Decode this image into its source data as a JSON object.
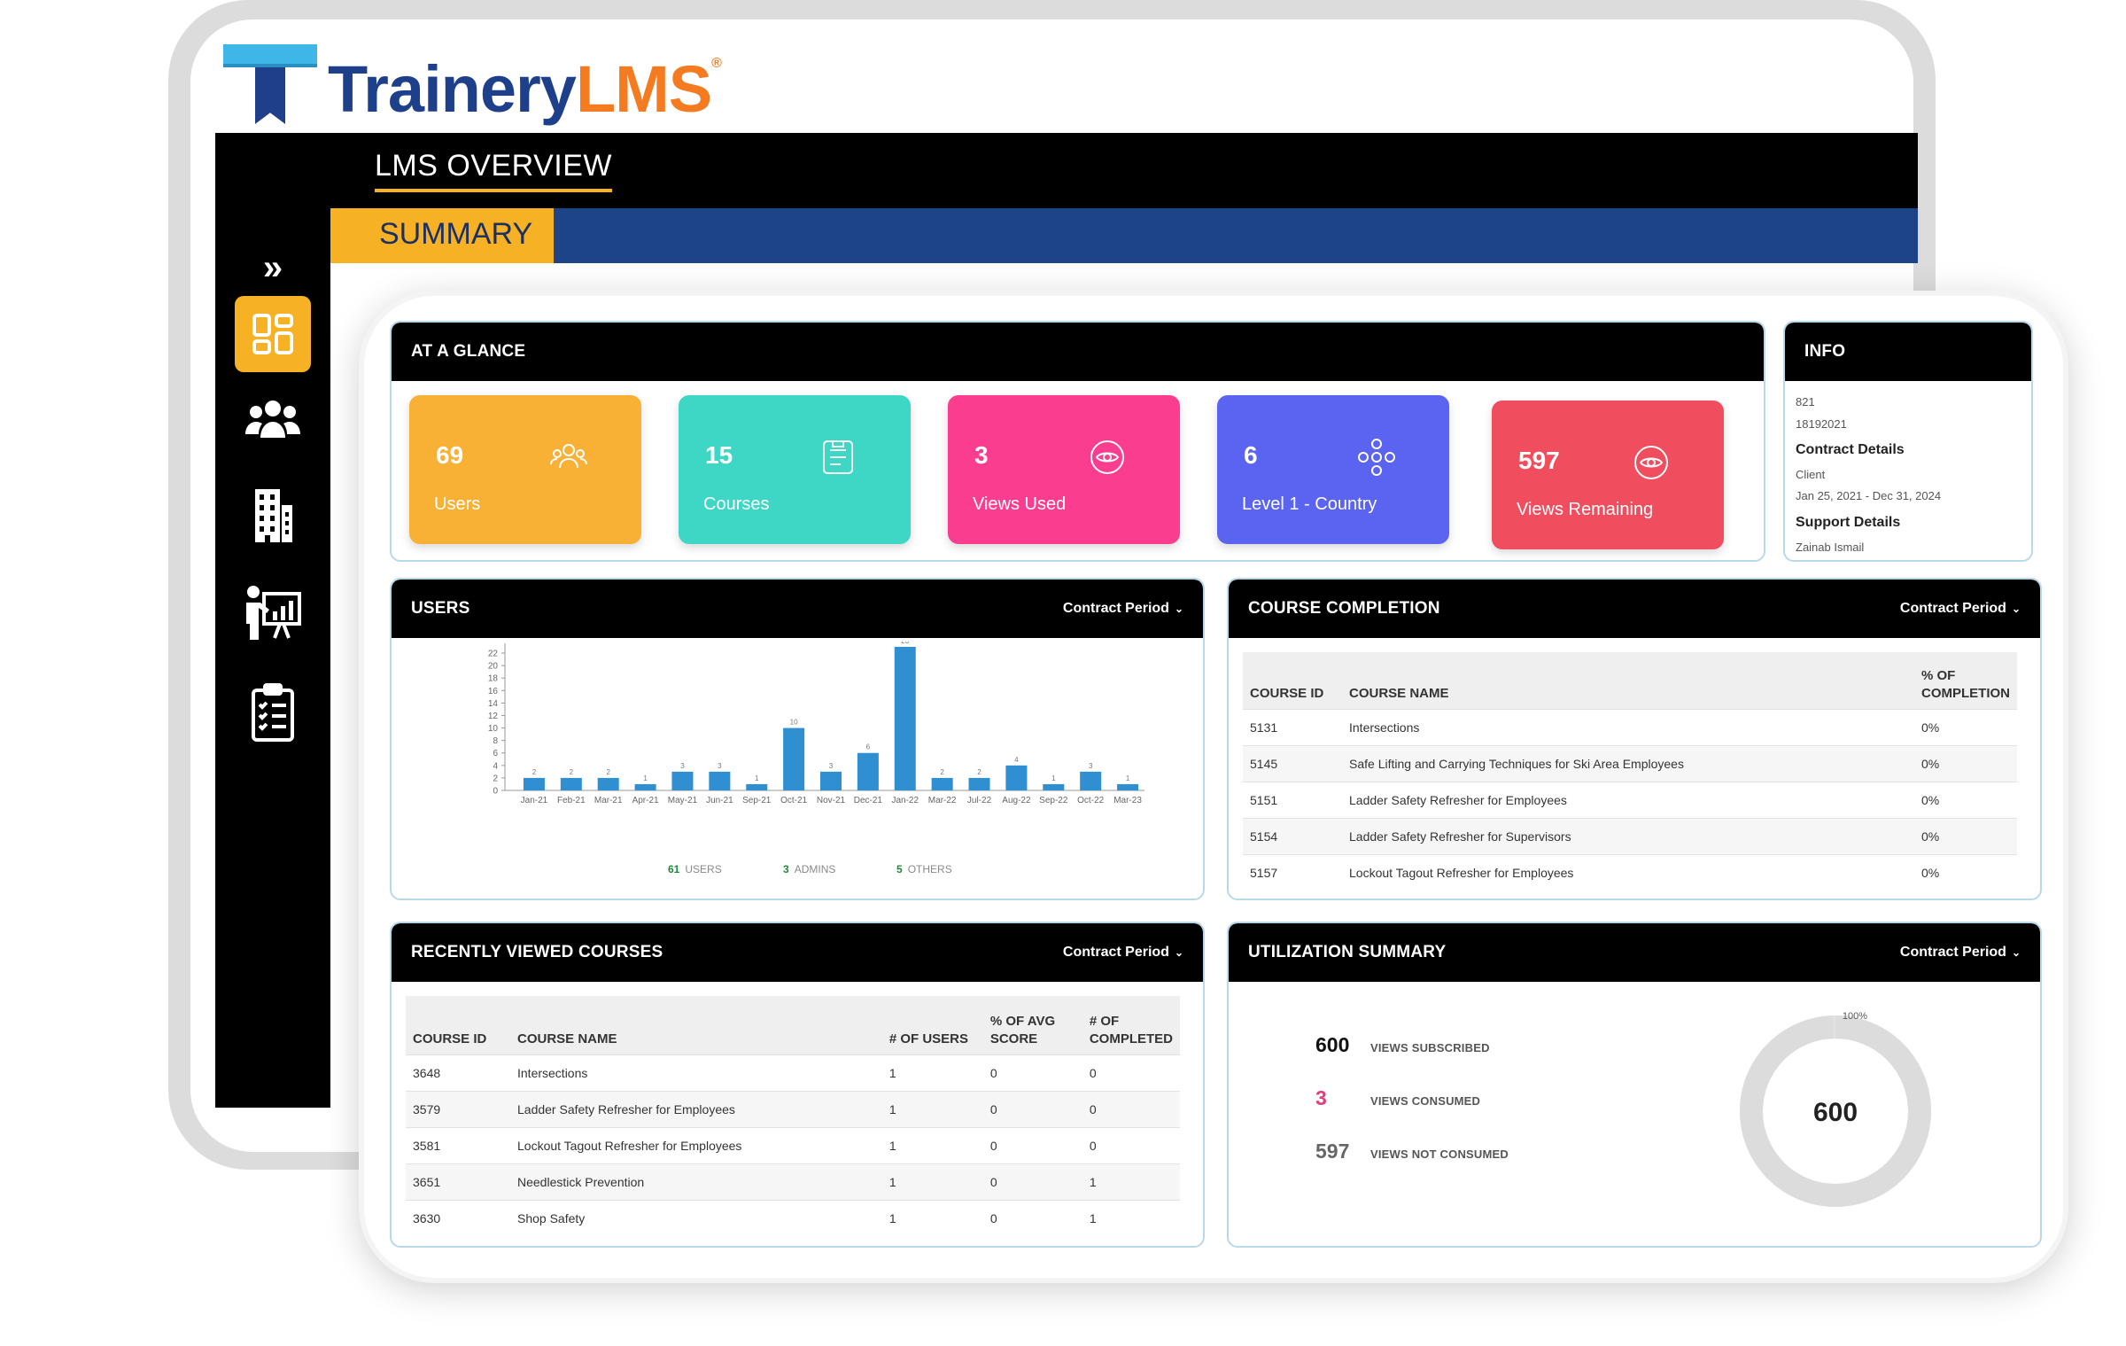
{
  "brand": {
    "name_primary": "Trainery",
    "name_accent": "LMS",
    "reg": "®"
  },
  "header": {
    "title": "LMS OVERVIEW",
    "tab": "SUMMARY"
  },
  "sidebar": {
    "items": [
      {
        "name": "dashboard-icon"
      },
      {
        "name": "users-icon"
      },
      {
        "name": "building-icon"
      },
      {
        "name": "presentation-icon"
      },
      {
        "name": "checklist-icon"
      }
    ]
  },
  "glance": {
    "title": "AT A GLANCE",
    "cards": [
      {
        "value": "69",
        "label": "Users",
        "color": "#f8b134",
        "icon": "users-icon"
      },
      {
        "value": "15",
        "label": "Courses",
        "color": "#3ed6c4",
        "icon": "courses-icon"
      },
      {
        "value": "3",
        "label": "Views Used",
        "color": "#fb3d8f",
        "icon": "eye-icon"
      },
      {
        "value": "6",
        "label": "Level 1 - Country",
        "color": "#5b63f1",
        "icon": "hierarchy-icon"
      },
      {
        "value": "597",
        "label": "Views Remaining",
        "color": "#f04d5e",
        "icon": "eye-icon"
      }
    ]
  },
  "info": {
    "title": "INFO",
    "line1": "821",
    "line2": "18192021",
    "contract_heading": "Contract Details",
    "client": "Client",
    "dates": "Jan 25, 2021 - Dec 31, 2024",
    "support_heading": "Support Details",
    "support_name": "Zainab Ismail"
  },
  "users_panel": {
    "title": "USERS",
    "period": "Contract Period",
    "legend": [
      {
        "value": "61",
        "label": "USERS"
      },
      {
        "value": "3",
        "label": "ADMINS"
      },
      {
        "value": "5",
        "label": "OTHERS"
      }
    ]
  },
  "chart_data": {
    "type": "bar",
    "categories": [
      "Jan-21",
      "Feb-21",
      "Mar-21",
      "Apr-21",
      "May-21",
      "Jun-21",
      "Sep-21",
      "Oct-21",
      "Nov-21",
      "Dec-21",
      "Jan-22",
      "Mar-22",
      "Jul-22",
      "Aug-22",
      "Sep-22",
      "Oct-22",
      "Mar-23"
    ],
    "values": [
      2,
      2,
      2,
      1,
      3,
      3,
      1,
      10,
      3,
      6,
      23,
      2,
      2,
      4,
      1,
      3,
      1
    ],
    "ylim": [
      0,
      23
    ],
    "yticks": [
      0,
      2,
      4,
      6,
      8,
      10,
      12,
      14,
      16,
      18,
      20,
      22
    ],
    "color": "#2f8fd0",
    "grid": false
  },
  "course_completion": {
    "title": "COURSE COMPLETION",
    "period": "Contract Period",
    "headers": [
      "COURSE ID",
      "COURSE NAME",
      "% OF COMPLETION"
    ],
    "rows": [
      [
        "5131",
        "Intersections",
        "0%"
      ],
      [
        "5145",
        "Safe Lifting and Carrying Techniques for Ski Area Employees",
        "0%"
      ],
      [
        "5151",
        "Ladder Safety Refresher for Employees",
        "0%"
      ],
      [
        "5154",
        "Ladder Safety Refresher for Supervisors",
        "0%"
      ],
      [
        "5157",
        "Lockout Tagout Refresher for Employees",
        "0%"
      ]
    ]
  },
  "recent": {
    "title": "RECENTLY VIEWED COURSES",
    "period": "Contract Period",
    "headers": [
      "COURSE ID",
      "COURSE NAME",
      "# OF USERS",
      "% OF AVG SCORE",
      "# OF COMPLETED"
    ],
    "rows": [
      [
        "3648",
        "Intersections",
        "1",
        "0",
        "0"
      ],
      [
        "3579",
        "Ladder Safety Refresher for Employees",
        "1",
        "0",
        "0"
      ],
      [
        "3581",
        "Lockout Tagout Refresher for Employees",
        "1",
        "0",
        "0"
      ],
      [
        "3651",
        "Needlestick Prevention",
        "1",
        "0",
        "1"
      ],
      [
        "3630",
        "Shop Safety",
        "1",
        "0",
        "1"
      ]
    ]
  },
  "utilization": {
    "title": "UTILIZATION SUMMARY",
    "period": "Contract Period",
    "rows": [
      {
        "value": "600",
        "label": "VIEWS SUBSCRIBED",
        "color": "#111111"
      },
      {
        "value": "3",
        "label": "VIEWS CONSUMED",
        "color": "#e23c7c"
      },
      {
        "value": "597",
        "label": "VIEWS NOT CONSUMED",
        "color": "#666666"
      }
    ],
    "donut_center": "600",
    "donut_pct_label": "100%",
    "donut_fraction": 0.995
  }
}
